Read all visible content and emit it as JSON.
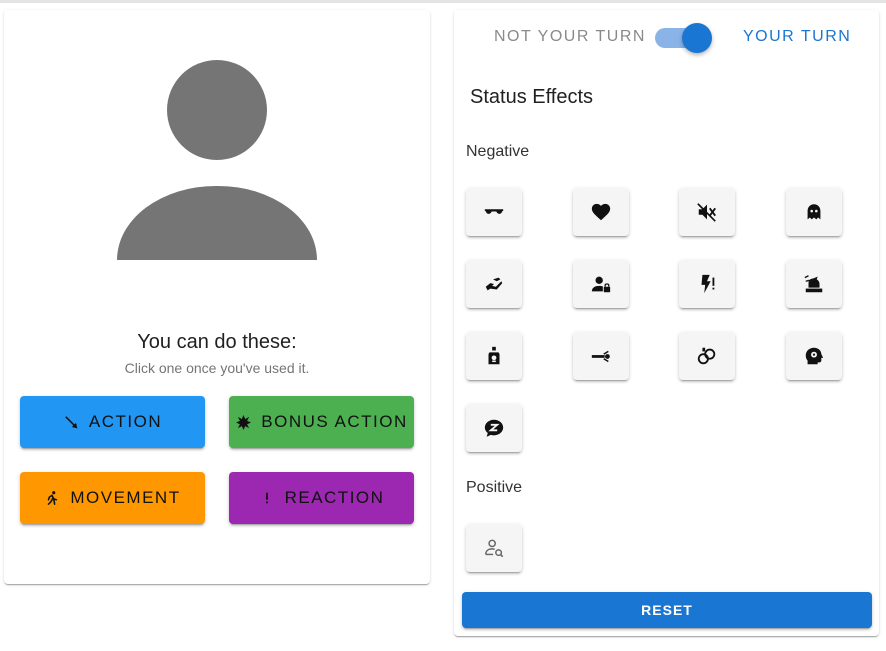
{
  "left_panel": {
    "title": "You can do these:",
    "subtitle": "Click one once you've used it.",
    "buttons": {
      "action": {
        "label": "ACTION",
        "icon": "sword-icon",
        "color": "#2196f3"
      },
      "bonus_action": {
        "label": "BONUS ACTION",
        "icon": "burst-icon",
        "color": "#4caf50"
      },
      "movement": {
        "label": "MOVEMENT",
        "icon": "running-icon",
        "color": "#ff9800"
      },
      "reaction": {
        "label": "REACTION",
        "icon": "exclamation-icon",
        "color": "#9c27b0"
      }
    }
  },
  "right_panel": {
    "turn_toggle": {
      "off_label": "NOT YOUR TURN",
      "on_label": "YOUR TURN",
      "checked": true,
      "accent": "#1976d2"
    },
    "status_title": "Status Effects",
    "negative_label": "Negative",
    "positive_label": "Positive",
    "negative_effects": [
      "blinded-icon",
      "charmed-icon",
      "deafened-icon",
      "frightened-icon",
      "grappled-icon",
      "incapacitated-icon",
      "paralyzed-icon",
      "petrified-icon",
      "poisoned-icon",
      "prone-icon",
      "restrained-icon",
      "stunned-icon",
      "unconscious-icon"
    ],
    "positive_effects": [
      "invisible-icon"
    ],
    "reset_label": "RESET"
  }
}
